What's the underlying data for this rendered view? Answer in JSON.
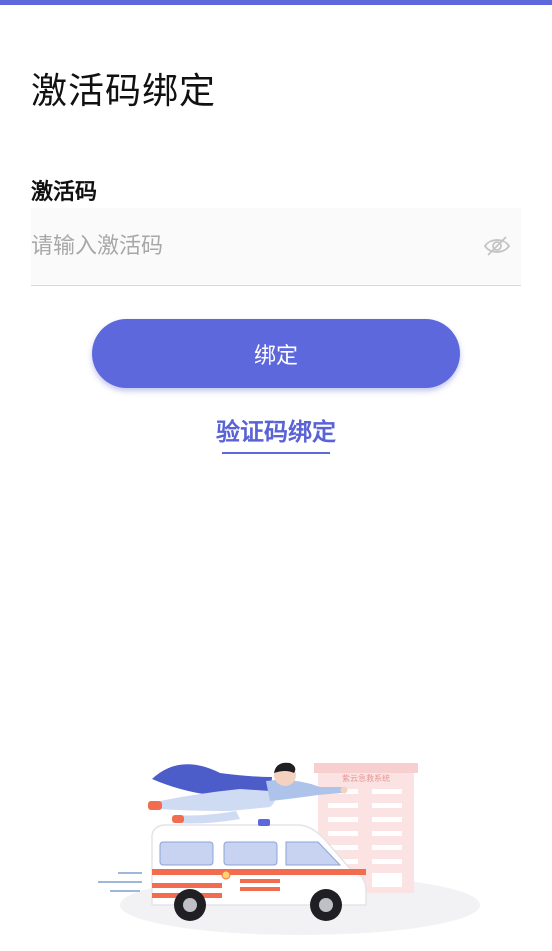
{
  "header": {
    "title": "激活码绑定"
  },
  "form": {
    "field_label": "激活码",
    "placeholder": "请输入激活码",
    "value": ""
  },
  "actions": {
    "bind_label": "绑定",
    "alt_link_label": "验证码绑定"
  },
  "illustration": {
    "building_sign": "紫云急救系统"
  },
  "colors": {
    "accent": "#5d68dc",
    "ambulance_stripe": "#f26d4f",
    "building": "#fbe3e3"
  },
  "icons": {
    "visibility": "eye-off-icon"
  }
}
